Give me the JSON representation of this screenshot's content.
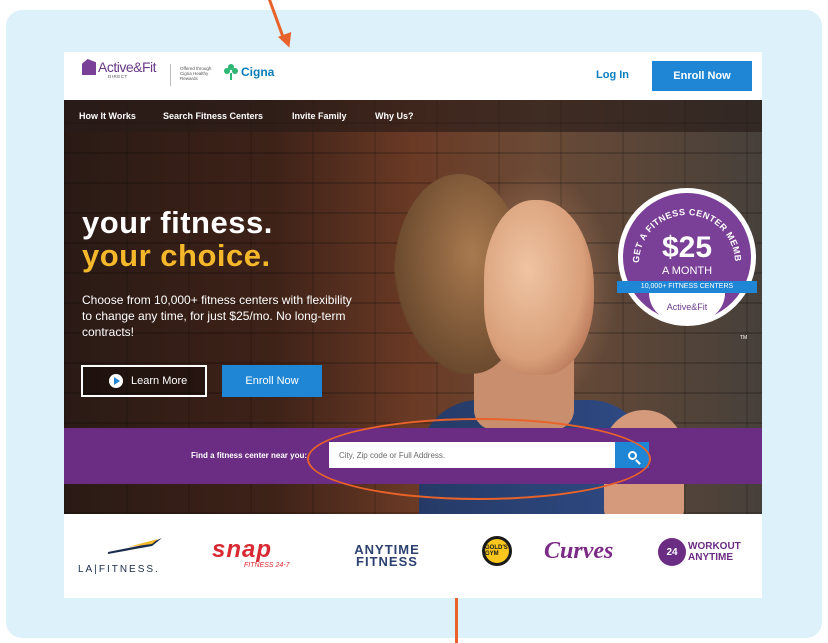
{
  "header": {
    "logo_text": "Active&Fit",
    "logo_sub": "DIRECT",
    "offered_text": "Offered through Cigna Healthy Rewards",
    "partner_logo": "Cigna",
    "login_label": "Log In",
    "enroll_label": "Enroll Now"
  },
  "nav": {
    "items": [
      {
        "label": "How It Works"
      },
      {
        "label": "Search Fitness Centers"
      },
      {
        "label": "Invite Family"
      },
      {
        "label": "Why Us?"
      }
    ]
  },
  "hero": {
    "headline_line1": "your fitness.",
    "headline_line2": "your choice.",
    "description": "Choose from 10,000+ fitness centers with flexibility to change any time, for just $25/mo. No long-term contracts!",
    "learn_more_label": "Learn More",
    "enroll_label": "Enroll Now"
  },
  "badge": {
    "arc_text": "GET A FITNESS CENTER MEMBERSHIP",
    "price": "$25",
    "period": "A MONTH",
    "ribbon": "10,000+ FITNESS CENTERS",
    "logo": "Active&Fit",
    "tm": "TM"
  },
  "search": {
    "label": "Find a fitness center near you:",
    "placeholder": "City, Zip code or Full Address."
  },
  "partners": {
    "la_fitness": "LA|FITNESS.",
    "snap": "snap",
    "snap_sub": "FITNESS 24-7",
    "anytime": "ANYTIME FITNESS",
    "golds": "GOLD'S GYM",
    "curves": "Curves",
    "workout_anytime": "WORKOUT ANYTIME",
    "workout_badge": "24"
  },
  "colors": {
    "frame_bg": "#dcf1f9",
    "primary_blue": "#1f86d6",
    "purple": "#6b2c83",
    "gold": "#f5b82a",
    "annotation": "#e8622a"
  }
}
